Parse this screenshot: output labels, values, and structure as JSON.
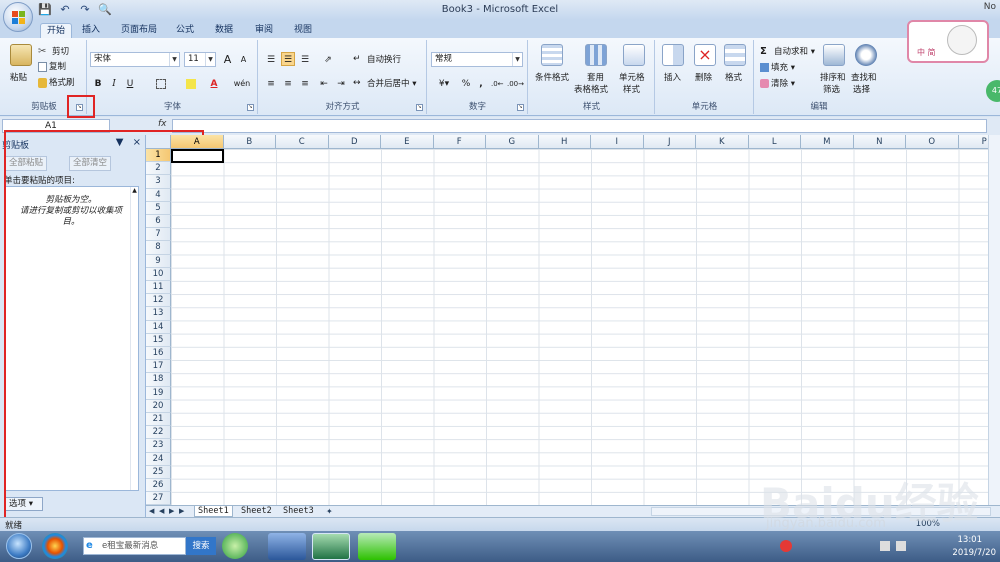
{
  "window": {
    "title": "Book3 - Microsoft Excel",
    "controls_text": "No"
  },
  "qat": {
    "icons": [
      "save-icon",
      "undo-icon",
      "redo-icon",
      "print-preview-icon"
    ]
  },
  "tabs": [
    "开始",
    "插入",
    "页面布局",
    "公式",
    "数据",
    "审阅",
    "视图"
  ],
  "ribbon": {
    "clipboard": {
      "paste": "粘贴",
      "cut": "剪切",
      "copy": "复制",
      "format_painter": "格式刷",
      "label": "剪贴板"
    },
    "font": {
      "name": "宋体",
      "size": "11",
      "bold": "B",
      "italic": "I",
      "underline": "U",
      "grow": "A",
      "shrink": "A",
      "label": "字体",
      "phonetic": "wén"
    },
    "alignment": {
      "wrap": "自动换行",
      "merge": "合并后居中",
      "label": "对齐方式"
    },
    "number": {
      "format": "常规",
      "percent": "%",
      "comma": ",",
      "label": "数字"
    },
    "styles": {
      "conditional": "条件格式",
      "table1": "套用",
      "table2": "表格格式",
      "cell_style1": "单元格",
      "cell_style2": "样式",
      "label": "样式"
    },
    "cells": {
      "insert": "插入",
      "delete": "删除",
      "format": "格式",
      "label": "单元格"
    },
    "editing": {
      "autosum": "自动求和",
      "fill": "填充",
      "clear": "清除",
      "sort1": "排序和",
      "sort2": "筛选",
      "find1": "查找和",
      "find2": "选择",
      "label": "编辑"
    }
  },
  "formula_bar": {
    "name_box": "A1",
    "fx": "fx",
    "value": ""
  },
  "clipboard_pane": {
    "title": "剪贴板",
    "paste_all": "全部粘贴",
    "clear_all": "全部清空",
    "instruction": "单击要粘贴的项目:",
    "empty_line1": "剪贴板为空。",
    "empty_line2": "请进行复制或剪切以收集项目。",
    "options": "选项"
  },
  "grid": {
    "columns": [
      "A",
      "B",
      "C",
      "D",
      "E",
      "F",
      "G",
      "H",
      "I",
      "J",
      "K",
      "L",
      "M",
      "N",
      "O",
      "P"
    ],
    "rows": [
      "1",
      "2",
      "3",
      "4",
      "5",
      "6",
      "7",
      "8",
      "9",
      "10",
      "11",
      "12",
      "13",
      "14",
      "15",
      "16",
      "17",
      "18",
      "19",
      "20",
      "21",
      "22",
      "23",
      "24",
      "25",
      "26",
      "27"
    ],
    "active_cell": "A1"
  },
  "sheets": [
    "Sheet1",
    "Sheet2",
    "Sheet3"
  ],
  "status": {
    "text": "就绪",
    "zoom": "100%"
  },
  "taskbar": {
    "search_placeholder": "e租宝最新消息",
    "search_button": "搜索",
    "time": "13:01",
    "date": "2019/7/20"
  },
  "watermark": {
    "logo": "Baidu经验",
    "url": "jingyan.baidu.com"
  },
  "badge": {
    "text": "中 简"
  },
  "side_circle": "47"
}
